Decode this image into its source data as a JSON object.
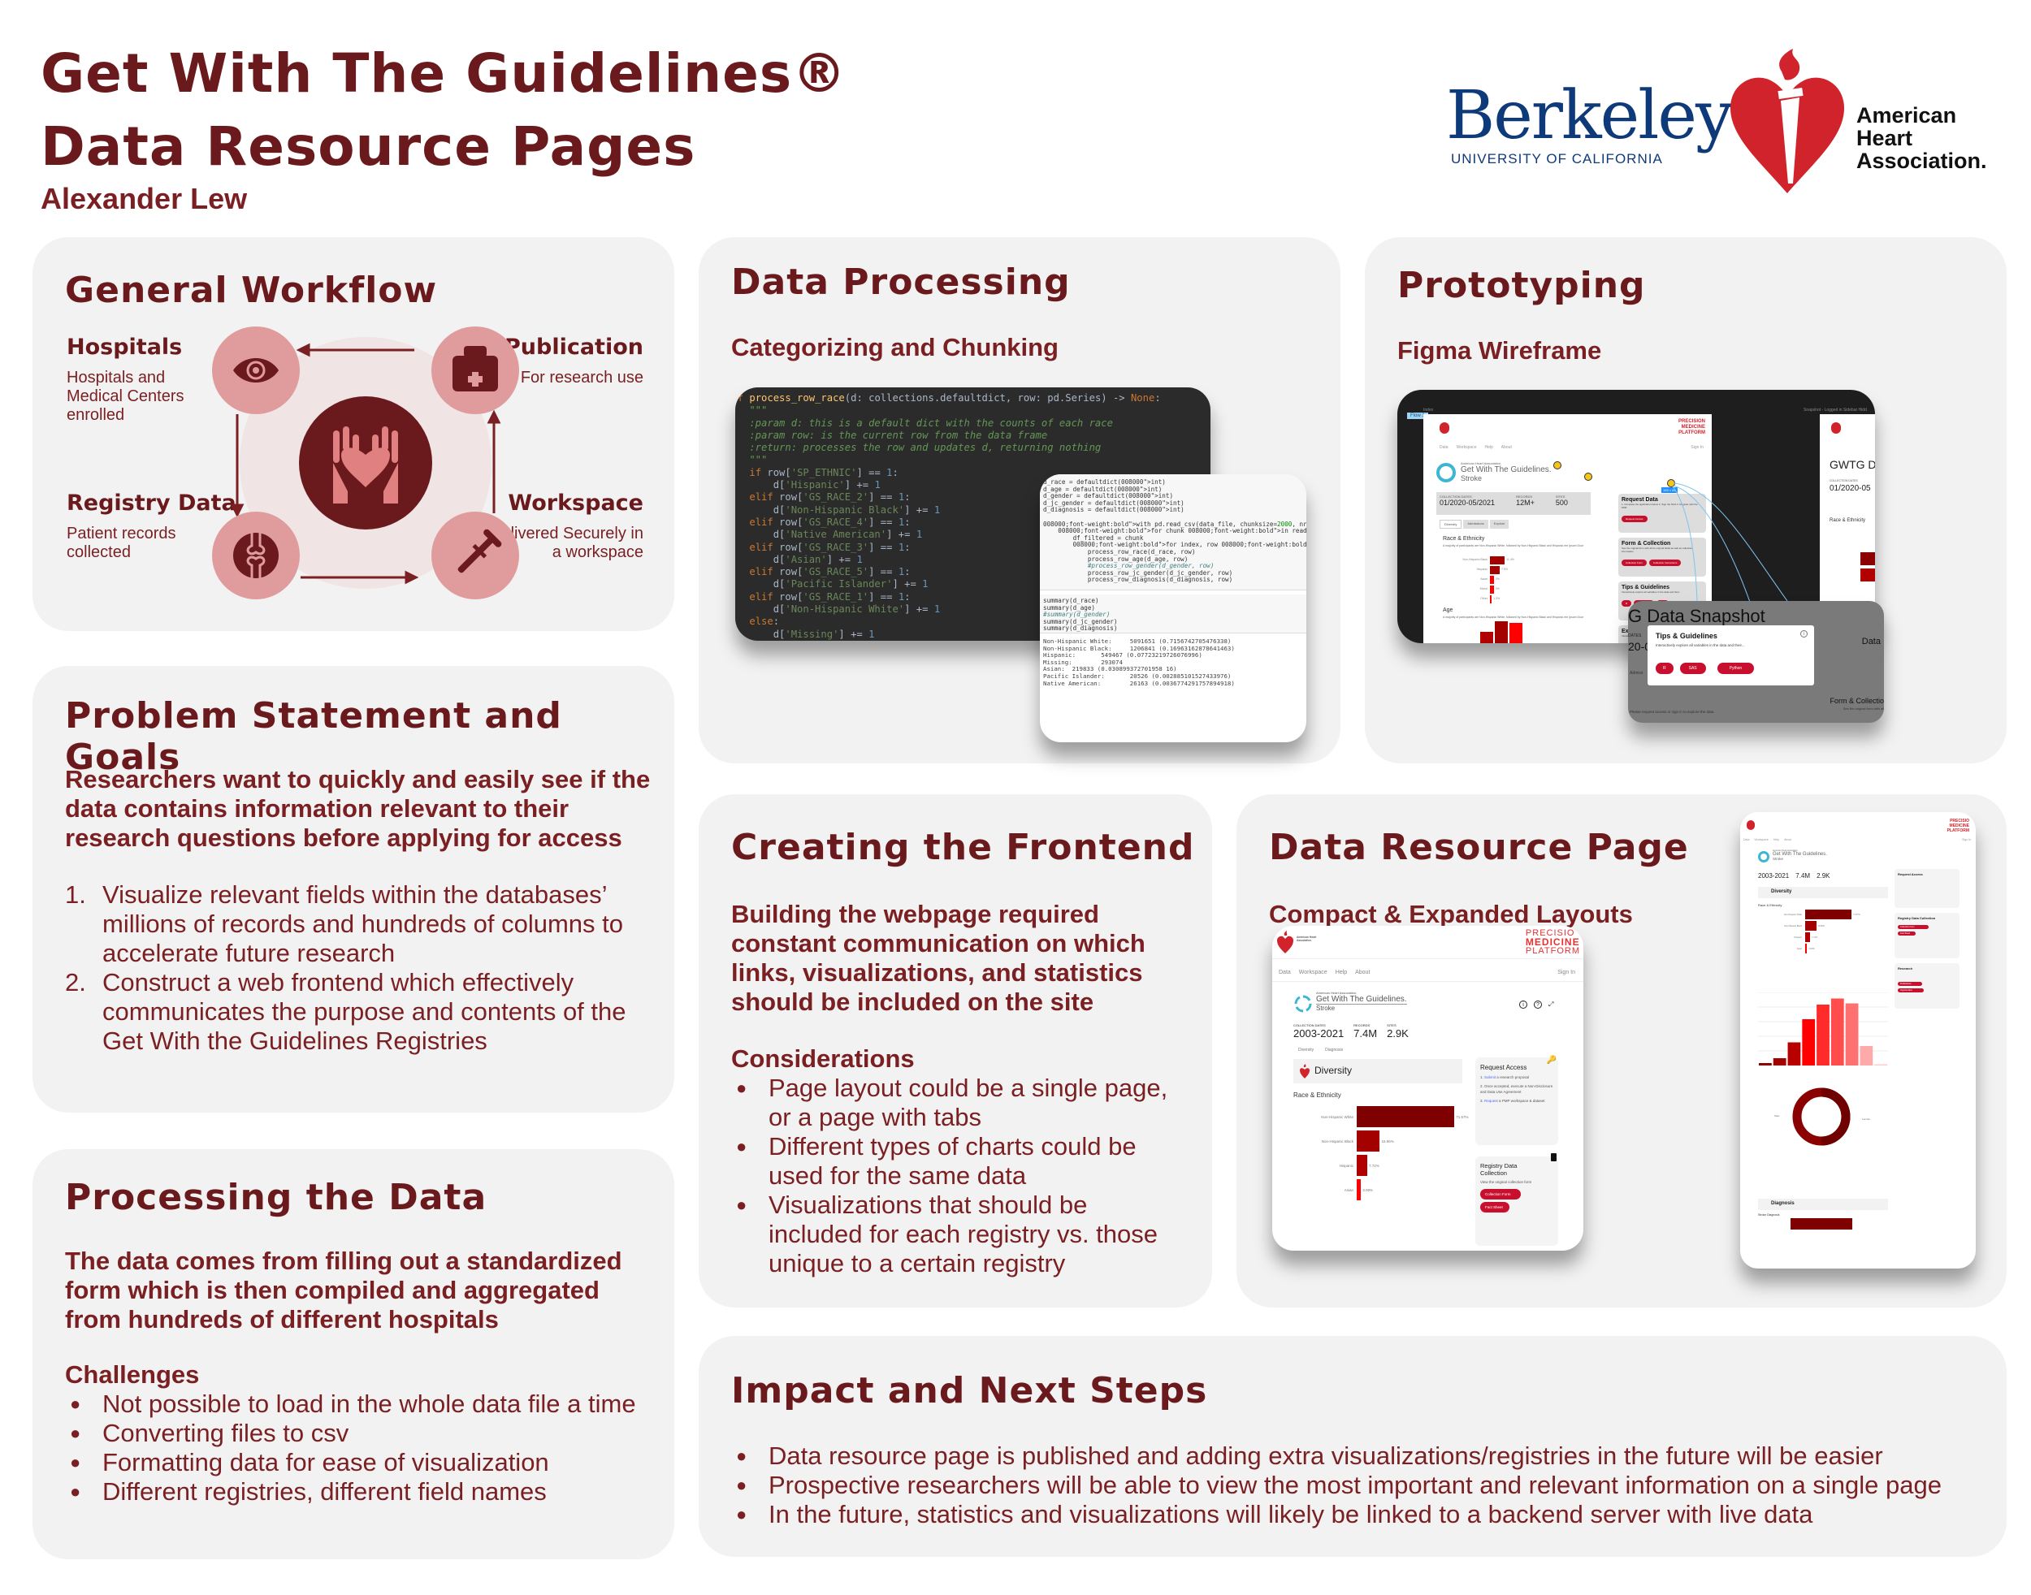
{
  "header": {
    "title_line1": "Get With The Guidelines®",
    "title_line2": "Data Resource Pages",
    "author": "Alexander Lew",
    "logos": {
      "berkeley_name": "Berkeley",
      "berkeley_sub": "UNIVERSITY OF CALIFORNIA",
      "aha_line1": "American",
      "aha_line2": "Heart",
      "aha_line3": "Association."
    }
  },
  "colors": {
    "maroon": "#6a1a1c",
    "text_red": "#7a1f22",
    "card_bg": "#f2f2f2",
    "pink_circle": "#e09c9c",
    "light_pink": "#f0e4e4",
    "berkeley_blue": "#0f3a7a",
    "aha_red": "#d0232c",
    "button_red": "#c8102e"
  },
  "workflow": {
    "title": "General Workflow",
    "steps": [
      {
        "label": "Hospitals",
        "desc": "Hospitals and Medical Centers enrolled",
        "icon": "eye-icon"
      },
      {
        "label": "Publication",
        "desc": "For research use",
        "icon": "medical-kit-icon"
      },
      {
        "label": "Registry Data",
        "desc": "Patient records collected",
        "icon": "bone-joint-icon"
      },
      {
        "label": "Workspace",
        "desc": "Delivered Securely in a workspace",
        "icon": "crutch-icon"
      }
    ],
    "center_icon": "hands-heart-icon"
  },
  "problem": {
    "title": "Problem Statement and Goals",
    "lead": "Researchers want to quickly and easily see if the data contains information relevant to their research questions before applying for access",
    "goals": [
      "Visualize relevant fields within the databases’ millions of records and hundreds of columns to accelerate future research",
      "Construct a web frontend which effectively communicates the purpose and contents of the Get With the Guidelines Registries"
    ]
  },
  "processing": {
    "title": "Processing the Data",
    "lead": "The data comes from filling out a standardized form which is then compiled and aggregated from hundreds of different hospitals",
    "challenges_title": "Challenges",
    "challenges": [
      "Not possible to load in the whole data file a time",
      "Converting files to csv",
      "Formatting data for ease of visualization",
      "Different registries, different field names"
    ]
  },
  "data_processing": {
    "title": "Data Processing",
    "subtitle": "Categorizing and Chunking",
    "code_dark": [
      "def process_row_race(d: collections.defaultdict, row: pd.Series) -> None:",
      "    \"\"\"",
      "    :param d: this is a default dict with the counts of each race",
      "    :param row: is the current row from the data frame",
      "    :return: processes the row and updates d, returning nothing",
      "    \"\"\"",
      "    if row['SP_ETHNIC'] == 1:",
      "        d['Hispanic'] += 1",
      "    elif row['GS_RACE_2'] == 1:",
      "        d['Non-Hispanic Black'] += 1",
      "    elif row['GS_RACE_4'] == 1:",
      "        d['Native American'] += 1",
      "    elif row['GS_RACE_3'] == 1:",
      "        d['Asian'] += 1",
      "    elif row['GS_RACE_5'] == 1:",
      "        d['Pacific Islander'] += 1",
      "    elif row['GS_RACE_1'] == 1:",
      "        d['Non-Hispanic White'] += 1",
      "    else:",
      "        d['Missing'] += 1"
    ],
    "code_light": [
      "d_race = defaultdict(int)",
      "d_age = defaultdict(int)",
      "d_gender = defaultdict(int)",
      "d_jc_gender = defaultdict(int)",
      "d_diagnosis = defaultdict(int)",
      "",
      "with pd.read_csv(data_file, chunksize=2000, nrows=14000000) as reader:",
      "    for chunk in reader:",
      "        df_filtered = chunk",
      "        for index, row in df_filtered.iterrows():",
      "            process_row_race(d_race, row)",
      "            process_row_age(d_age, row)",
      "            #process_row_gender(d_gender, row)",
      "            process_row_jc_gender(d_jc_gender, row)",
      "            process_row_diagnosis(d_diagnosis, row)"
    ],
    "code_summary": [
      "summary(d_race)",
      "summary(d_age)",
      "#summary(d_gender)",
      "summary(d_jc_gender)",
      "summary(d_diagnosis)"
    ],
    "output": [
      "Non-Hispanic White:     5091651 (0.7156742705476338)",
      "Non-Hispanic Black:     1206841 (0.16963162878641463)",
      "Hispanic:       549467 (0.07723219726076996)",
      "Missing:        293074",
      "Asian:  219833 (0.030899372701958 16)",
      "Pacific Islander:       20526 (0.002885101527433976)",
      "Native American:        26163 (0.0036774291757894918)"
    ]
  },
  "prototyping": {
    "title": "Prototyping",
    "subtitle": "Figma Wireframe",
    "wire": {
      "flow_label": "Flow 1",
      "frame_label": "Index",
      "frame2_label": "Snapshot - Logged in Sidebar Hidd",
      "nav": [
        "Data",
        "Workspace",
        "Help",
        "About"
      ],
      "sign_in": "Sign In",
      "brand_small": "American Heart Association.",
      "brand_big": "Get With The Guidelines.",
      "brand_sub": "Stroke",
      "precision": [
        "PRECISION",
        "MEDICINE",
        "PLATFORM"
      ],
      "stats": [
        {
          "label": "COLLECTION DATES",
          "value": "01/2020-05/2021"
        },
        {
          "label": "RECORDS",
          "value": "12M+"
        },
        {
          "label": "SITES",
          "value": "500"
        }
      ],
      "tabs": [
        "Diversity",
        "Admissions",
        "Explore"
      ],
      "race_title": "Race & Ethnicity",
      "race_desc": "A majority of participants are Non-Hispanic White, followed by Non-Hispanic Black and Hispanic em Ipsum Door",
      "race_bars": [
        {
          "label": "Non-Hispanic Black",
          "value": "11.4%"
        },
        {
          "label": "Hispanic",
          "value": "7.5%"
        },
        {
          "label": "Asian",
          "value": "3%"
        },
        {
          "label": "Mixed",
          "value": "3%"
        },
        {
          "label": "Other",
          "value": "1.3%"
        }
      ],
      "age_title": "Age",
      "age_desc": "A majority of participants are Non-Hispanic White, followed by Non-Hispanic Black and Hispanic em Ipsum Door",
      "side_cards": [
        {
          "title": "Request Data",
          "body": "1. Complete the application below 2. Sign the NDA 3. Register with the PMP",
          "buttons": [
            "Request Access"
          ]
        },
        {
          "title": "Form & Collection",
          "body": "See the original form with all its original fields as well as collection information",
          "buttons": [
            "Collection Form",
            "Collection Instructions"
          ]
        },
        {
          "title": "Tips & Guidelines",
          "body": "Interactively explore all variables in the data and their...",
          "buttons": [
            "R",
            "Manuscript",
            "Tips"
          ]
        },
        {
          "title": "Examples",
          "body": "Interactively explore all variables in the data and their...",
          "buttons": []
        }
      ],
      "size_tag": "193 × 65",
      "frame2_title": "GWTG Da",
      "frame2_dates_label": "COLLECTION DATES",
      "frame2_dates": "01/2020-05",
      "frame2_tabs": [
        "Diversity",
        "Admission"
      ],
      "frame2_race": "Race & Ethnicity",
      "frame2_bars": [
        "Hispanic White",
        "Hispanic Black"
      ],
      "snapshot_title": "G Data Snapshot",
      "snapshot_dates": "DATES",
      "snapshot_dates_val": "20-0",
      "snapshot_side": "Data",
      "snapshot_tab": "Admiss",
      "snapshot_form": "Form & Collectio",
      "snapshot_form_sub": "See the original form with all",
      "modal_title": "Tips & Guidelines",
      "modal_body": "Interactively explore all variables in the data and their...",
      "modal_buttons": [
        "R",
        "SAS",
        "Python"
      ],
      "snapshot_footer": "Please request access or sign in to explore the data."
    }
  },
  "frontend": {
    "title": "Creating the Frontend",
    "lead": "Building the webpage required constant communication on which links, visualizations, and statistics should be included on the site",
    "considerations_title": "Considerations",
    "considerations": [
      "Page layout could be a single page, or a page with tabs",
      "Different types of charts could be used for the same data",
      "Visualizations that should be included for each registry vs. those unique to a certain registry"
    ]
  },
  "resource_page": {
    "title": "Data Resource Page",
    "subtitle": "Compact & Expanded Layouts",
    "site": {
      "aha_logo_text": "American Heart Association.",
      "precision": [
        "PRECISIO",
        "MEDICINE",
        "PLATFORM"
      ],
      "nav": [
        "Data",
        "Workspace",
        "Help",
        "About"
      ],
      "sign_in": "Sign In",
      "brand_small": "American Heart Association.",
      "brand_big": "Get With The Guidelines.",
      "brand_sub": "Stroke",
      "stats": [
        {
          "label": "COLLECTION DATES",
          "value": "2003-2021"
        },
        {
          "label": "RECORDS",
          "value": "7.4M"
        },
        {
          "label": "SITES",
          "value": "2.9K"
        }
      ],
      "tabs": [
        "Diversity",
        "Diagnosis"
      ],
      "section_title": "Diversity",
      "race_title": "Race & Ethnicity",
      "race_bars": [
        {
          "label": "Non-Hispanic White",
          "value": 71.57,
          "text": "71.57%",
          "color": "#7f0000"
        },
        {
          "label": "Non-Hispanic Black",
          "value": 16.96,
          "text": "16.96%",
          "color": "#a30000"
        },
        {
          "label": "Hispanic",
          "value": 7.72,
          "text": "7.72%",
          "color": "#b00000"
        },
        {
          "label": "Asian",
          "value": 3.09,
          "text": "3.09%",
          "color": "#ff0000"
        }
      ],
      "request": {
        "title": "Request Access",
        "steps": [
          {
            "link": "Submit",
            "prefix": "1. ",
            "rest": " a research proposal"
          },
          {
            "link": "",
            "prefix": "2. ",
            "rest": "Once accepted, execute a Non-Disclosure and Data Use Agreement"
          },
          {
            "link": "Request",
            "prefix": "3. ",
            "rest": " a PMP workspace & dataset"
          }
        ]
      },
      "registry": {
        "title": "Registry Data Collection",
        "body": "View the original collection form",
        "buttons": [
          "Collection Form",
          "Fact Sheet"
        ]
      },
      "research": {
        "title": "Research",
        "body": "Search for published research on Get With the Guidelines and view current research opportunities",
        "buttons": [
          "Publications",
          "Opportunities"
        ]
      },
      "age_bars": [
        2,
        6,
        19,
        38,
        50,
        55,
        51,
        16,
        1
      ],
      "age_colors": [
        "#8b0000",
        "#a30000",
        "#b80000",
        "#ff0000",
        "#ff2a2a",
        "#ff4d4d",
        "#ff7070",
        "#ffaaaa",
        "#ffcccc"
      ],
      "gender_labels": [
        "Male",
        "Female"
      ],
      "diagnosis_title": "Diagnosis",
      "diagnosis_sub": "Stroke Diagnosis",
      "diagnosis_bar": "Ischemic stroke"
    }
  },
  "impact": {
    "title": "Impact and Next Steps",
    "items": [
      "Data resource page is published and adding extra visualizations/registries in the future will be easier",
      "Prospective researchers will be able to view the most important and relevant information on a single page",
      "In the future, statistics and visualizations will likely be linked to a backend server with live data"
    ]
  }
}
